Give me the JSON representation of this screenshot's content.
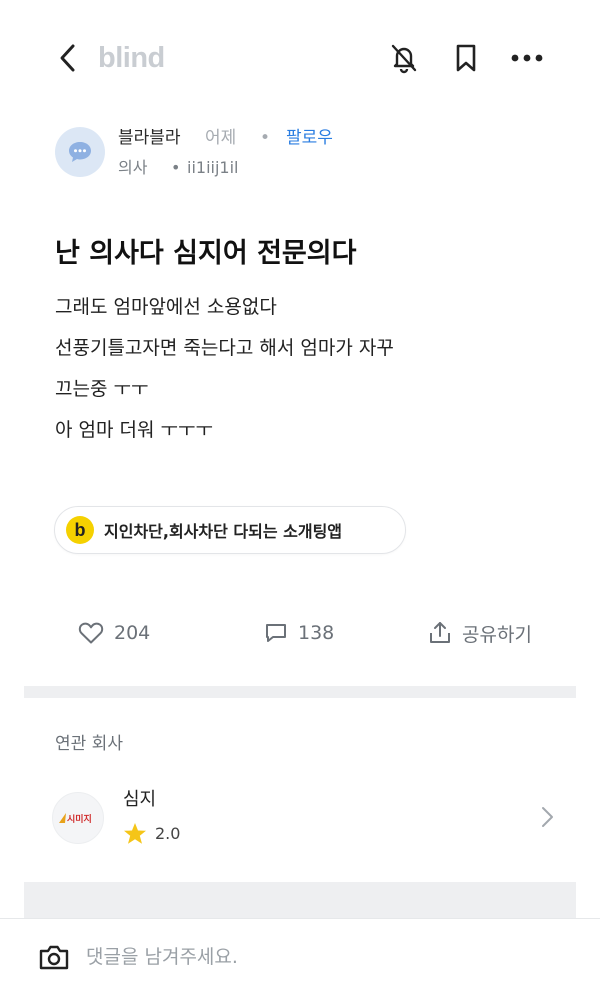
{
  "header": {
    "logo_text": "blind",
    "icons": [
      "back-arrow-icon",
      "bell-off-icon",
      "bookmark-icon",
      "more-icon"
    ]
  },
  "author": {
    "name": "블라블라",
    "time": "어제",
    "separator": "•",
    "follow_label": "팔로우",
    "job": "의사",
    "id": "ii1iij1il",
    "avatar_color": "#dce7f5"
  },
  "post": {
    "title": "난 의사다 심지어 전문의다",
    "lines": [
      "그래도 엄마앞에선 소용없다",
      "선풍기틀고자면 죽는다고 해서 엄마가 자꾸",
      "끄는중 ㅜㅜ",
      "아 엄마 더워 ㅜㅜㅜ"
    ]
  },
  "ad": {
    "logo_letter": "b",
    "text": "지인차단,회사차단 다되는 소개팅앱",
    "logo_color": "#f5d100"
  },
  "actions": {
    "like_count": "204",
    "comment_count": "138",
    "share_label": "공유하기"
  },
  "related": {
    "heading": "연관 회사",
    "company": {
      "name": "심지",
      "logo_text": "시미지",
      "rating": "2.0",
      "star_color": "#f5c518"
    }
  },
  "comment_bar": {
    "placeholder": "댓글을 남겨주세요."
  },
  "colors": {
    "accent": "#2a7de1",
    "band": "#eeeff1"
  }
}
